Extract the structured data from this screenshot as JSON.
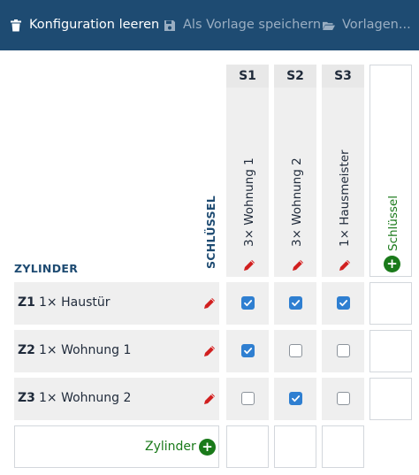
{
  "toolbar": {
    "clear_label": "Konfiguration leeren",
    "save_template_label": "Als Vorlage speichern",
    "templates_label": "Vorlagen..."
  },
  "table": {
    "zylinder_header": "ZYLINDER",
    "schluessel_header": "SCHLÜSSEL",
    "keys": [
      {
        "id": "S1",
        "label": "3×  Wohnung 1"
      },
      {
        "id": "S2",
        "label": "3×  Wohnung 2"
      },
      {
        "id": "S3",
        "label": "1×  Hausmeister"
      }
    ],
    "add_key_label": "Schlüssel",
    "cylinders": [
      {
        "id": "Z1",
        "label": "1× Haustür",
        "access": [
          true,
          true,
          true
        ]
      },
      {
        "id": "Z2",
        "label": "1× Wohnung 1",
        "access": [
          true,
          false,
          false
        ]
      },
      {
        "id": "Z3",
        "label": "1× Wohnung 2",
        "access": [
          false,
          true,
          false
        ]
      }
    ],
    "add_cylinder_label": "Zylinder"
  },
  "colors": {
    "toolbar_bg": "#1e4b72",
    "accent_blue": "#2f7fd1",
    "edit_red": "#d11f1f",
    "add_green": "#1a7a1a"
  }
}
